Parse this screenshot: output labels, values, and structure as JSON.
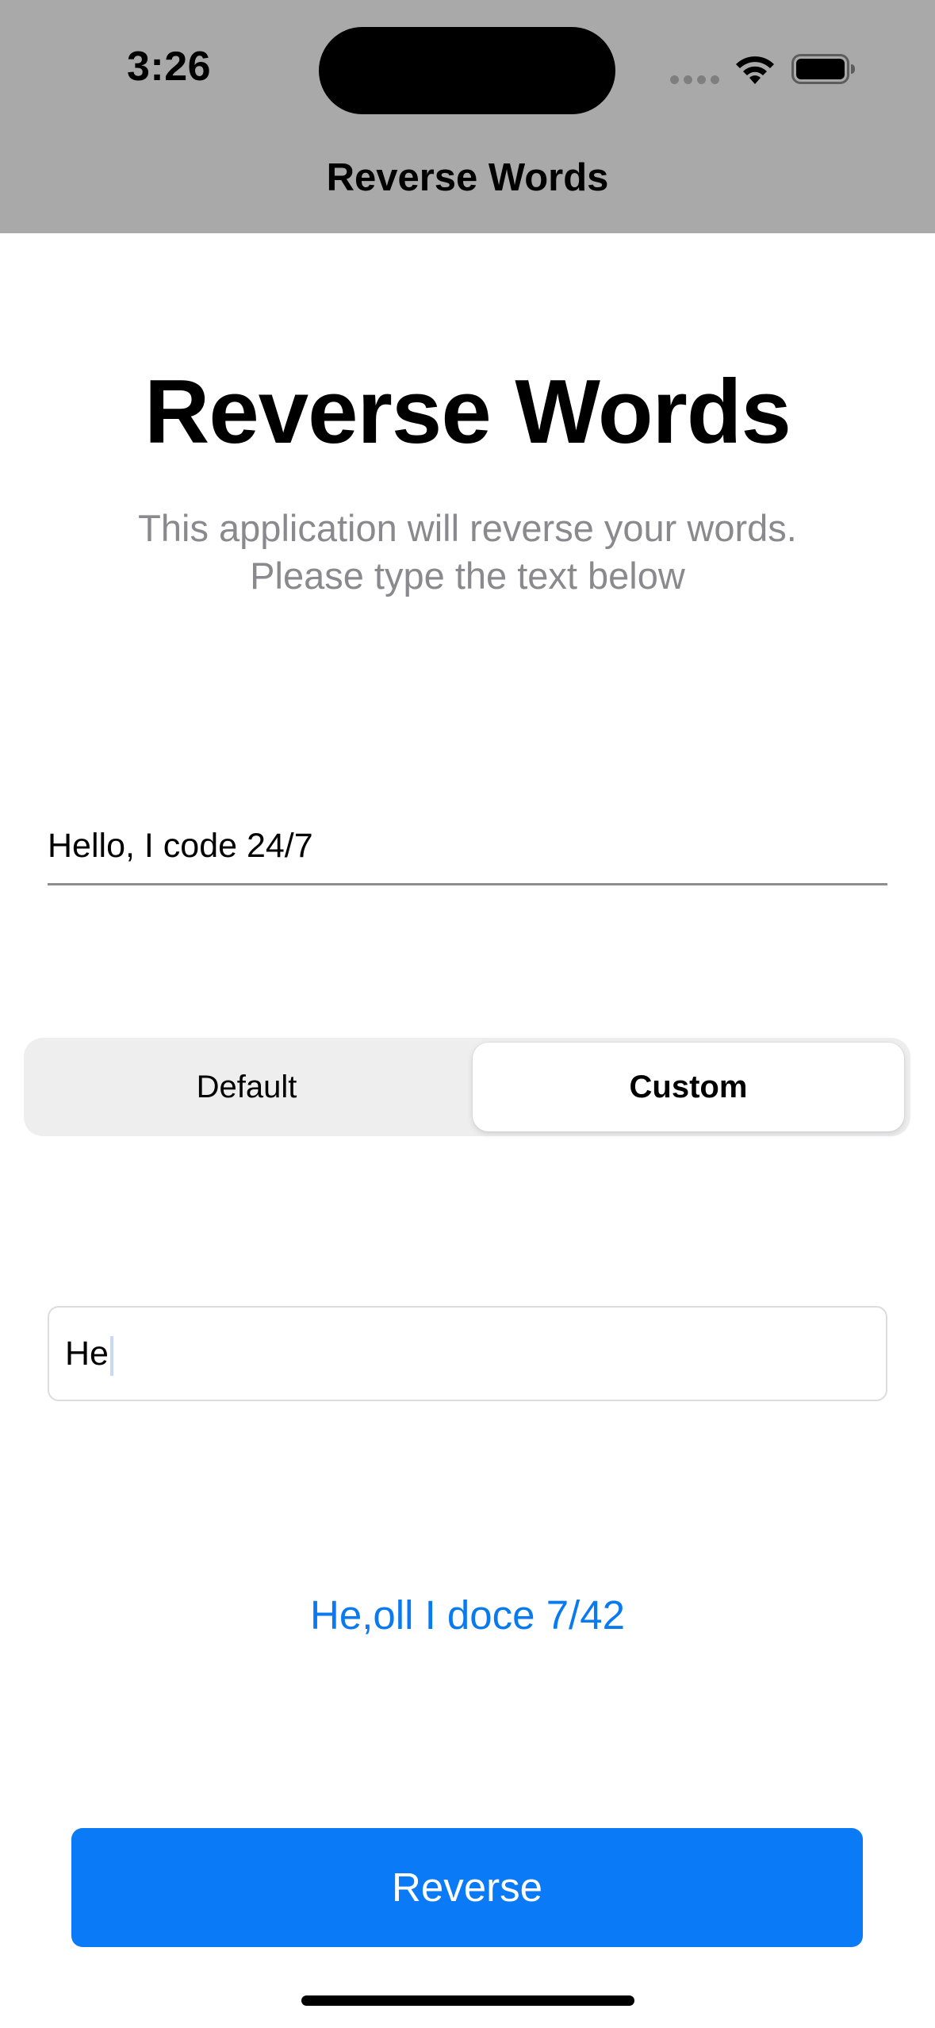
{
  "status_bar": {
    "time": "3:26",
    "icons": [
      "cellular-signal-icon",
      "wifi-icon",
      "battery-icon"
    ]
  },
  "nav": {
    "title": "Reverse Words"
  },
  "header": {
    "title": "Reverse Words",
    "subtitle_line1": "This application will reverse your words.",
    "subtitle_line2": "Please type the text below"
  },
  "input": {
    "value": "Hello, I code 24/7"
  },
  "segmented_control": {
    "options": [
      "Default",
      "Custom"
    ],
    "selected": "Custom"
  },
  "custom_input": {
    "value": "He"
  },
  "result": {
    "text": "He,oll I doce 7/42"
  },
  "button": {
    "label": "Reverse"
  },
  "colors": {
    "header_bg": "#a9a9a9",
    "accent": "#0a7af6",
    "result_text": "#0a7af0",
    "subtitle_gray": "#8a8a8e"
  }
}
